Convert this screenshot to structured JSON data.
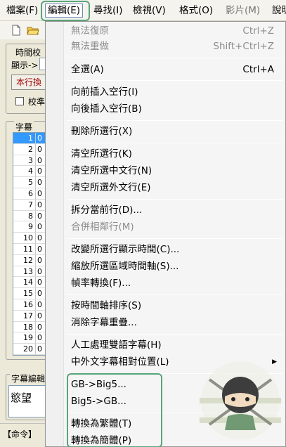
{
  "menubar": {
    "items": [
      {
        "label": "檔案(F)"
      },
      {
        "label": "編輯(E)"
      },
      {
        "label": "尋找(I)"
      },
      {
        "label": "檢視(V)"
      },
      {
        "label": "格式(O)"
      },
      {
        "label": "影片(M)"
      },
      {
        "label": "說明"
      }
    ]
  },
  "background": {
    "timing_label": "時間校",
    "display_label": "顯示->",
    "row_button": "本行換",
    "checkbox_label": "校準",
    "list_label": "字幕",
    "edit_label": "字幕編輯",
    "edit_text": "慾望",
    "status_text": "【命令】",
    "rows": [
      {
        "num": "1",
        "val": "0"
      },
      {
        "num": "2",
        "val": "0"
      },
      {
        "num": "3",
        "val": "0"
      },
      {
        "num": "4",
        "val": "0"
      },
      {
        "num": "5",
        "val": "0"
      },
      {
        "num": "6",
        "val": "0"
      },
      {
        "num": "7",
        "val": "0"
      },
      {
        "num": "8",
        "val": "0"
      },
      {
        "num": "9",
        "val": "0"
      },
      {
        "num": "10",
        "val": "0"
      },
      {
        "num": "11",
        "val": "0"
      },
      {
        "num": "12",
        "val": "0"
      },
      {
        "num": "13",
        "val": "0"
      },
      {
        "num": "14",
        "val": "0"
      },
      {
        "num": "15",
        "val": "0"
      },
      {
        "num": "16",
        "val": "0"
      },
      {
        "num": "17",
        "val": "0"
      },
      {
        "num": "18",
        "val": "0"
      },
      {
        "num": "19",
        "val": "0"
      },
      {
        "num": "20",
        "val": "0"
      }
    ]
  },
  "edit_menu": {
    "undo": {
      "label": "無法復原",
      "shortcut": "Ctrl+Z"
    },
    "redo": {
      "label": "無法重做",
      "shortcut": "Shift+Ctrl+Z"
    },
    "select_all": {
      "label": "全選(A)",
      "shortcut": "Ctrl+A"
    },
    "insert_before": "向前插入空行(I)",
    "insert_after": "向後插入空行(B)",
    "delete_selected": "刪除所選行(X)",
    "clear_selected": "清空所選行(K)",
    "clear_chinese": "清空所選中文行(N)",
    "clear_foreign": "清空所選外文行(E)",
    "split_line": "拆分當前行(D)...",
    "merge_lines": "合併相鄰行(M)",
    "change_display_time": "改變所選行顯示時間(C)...",
    "scale_timeline": "縮放所選區域時間軸(S)...",
    "frame_rate": "幀率轉換(F)...",
    "sort_by_time": "按時間軸排序(S)",
    "remove_overlap": "消除字幕重疊...",
    "bilingual": "人工處理雙語字幕(H)",
    "relative_position": "中外文字幕相對位置(L)",
    "gb_to_big5": "GB->Big5...",
    "big5_to_gb": "Big5->GB...",
    "to_traditional": "轉換為繁體(T)",
    "to_simplified": "轉換為簡體(P)"
  },
  "colors": {
    "highlight_border": "#5aa57a",
    "selection": "#3399ff",
    "disabled_text": "#8d8d8d"
  },
  "icons": [
    "new-file-icon",
    "open-folder-icon",
    "submenu-arrow-icon",
    "ninja-logo"
  ]
}
